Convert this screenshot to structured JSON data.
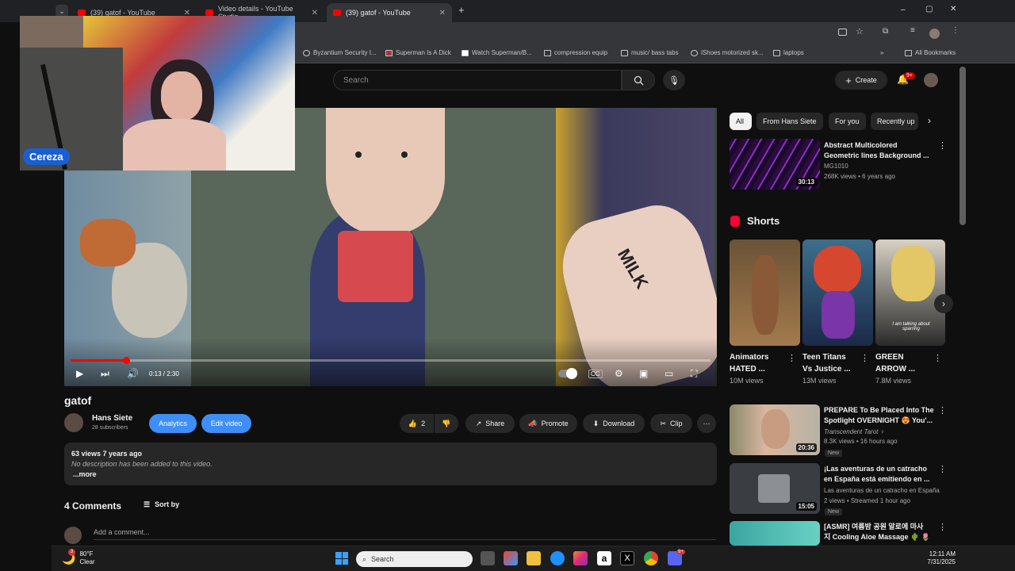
{
  "browser": {
    "tabs": [
      {
        "title": "(39) gatof - YouTube",
        "active": false
      },
      {
        "title": "Video details - YouTube Studio",
        "active": false
      },
      {
        "title": "(39) gatof - YouTube",
        "active": true
      }
    ],
    "new_tab": "+",
    "bookmarks": [
      "Byzantium Security I...",
      "Superman Is A Dick",
      "Watch Superman/B...",
      "compression equip",
      "music/ bass tabs",
      "iShoes motorized sk...",
      "laptops"
    ],
    "all_bookmarks": "All Bookmarks",
    "window_controls": [
      "–",
      "▢",
      "✕"
    ]
  },
  "youtube": {
    "search_placeholder": "Search",
    "create_label": "Create",
    "notification_count": "9+"
  },
  "stream_overlay": {
    "name": "Cereza"
  },
  "player": {
    "time": "0:13 / 2:30",
    "progress": 0.087
  },
  "video": {
    "title": "gatof",
    "channel": "Hans Siete",
    "subscribers": "28 subscribers",
    "analytics_label": "Analytics",
    "edit_label": "Edit video",
    "likes": "2",
    "share_label": "Share",
    "promote_label": "Promote",
    "download_label": "Download",
    "clip_label": "Clip",
    "views_line": "63 views  7 years ago",
    "description": "No description has been added to this video.",
    "more_label": "...more",
    "milk_text": "MILK"
  },
  "comments": {
    "count_label": "4 Comments",
    "sort_label": "Sort by",
    "add_placeholder": "Add a comment..."
  },
  "sidebar": {
    "chips": [
      "All",
      "From Hans Siete",
      "For you",
      "Recently up"
    ],
    "top_video": {
      "title_1": "Abstract Multicolored",
      "title_2": "Geometric lines Background ...",
      "channel": "MG1010",
      "meta": "268K views • 6 years ago",
      "duration": "30:13"
    },
    "shorts_heading": "Shorts",
    "shorts": [
      {
        "title_1": "Animators",
        "title_2": "HATED ...",
        "views": "10M views"
      },
      {
        "title_1": "Teen Titans",
        "title_2": "Vs Justice ...",
        "views": "13M views"
      },
      {
        "title_1": "GREEN",
        "title_2": "ARROW ...",
        "views": "7.8M views"
      }
    ],
    "short_caption": "I am talking about sparring",
    "videos": [
      {
        "title_1": "PREPARE To Be Placed Into The",
        "title_2": "Spotlight OVERNIGHT 😍 You'...",
        "channel": "Transcendent Tarot ♀",
        "meta": "8.3K views • 16 hours ago",
        "badge": "New",
        "duration": "20:36"
      },
      {
        "title_1": "¡Las aventuras de un catracho",
        "title_2": "en España está emitiendo en ...",
        "channel": "Las aventuras de un catracho en España",
        "meta": "2 views • Streamed 1 hour ago",
        "badge": "New",
        "duration": "15:05"
      },
      {
        "title_1": "[ASMR] 여름밤 공원 알로에 마사",
        "title_2": "지 Cooling Aloe Massage 🌵 🌷",
        "channel": "",
        "meta": "",
        "badge": "",
        "duration": ""
      }
    ]
  },
  "taskbar": {
    "weather_temp": "80°F",
    "weather_cond": "Clear",
    "search_label": "Search",
    "time": "12:11 AM",
    "date": "7/31/2025",
    "weather_badge": "3",
    "discord_badge": "9+"
  },
  "colors": {
    "yt_red": "#ff0000",
    "accent_blue": "#3e8ef7",
    "bg": "#0f0f0f"
  }
}
